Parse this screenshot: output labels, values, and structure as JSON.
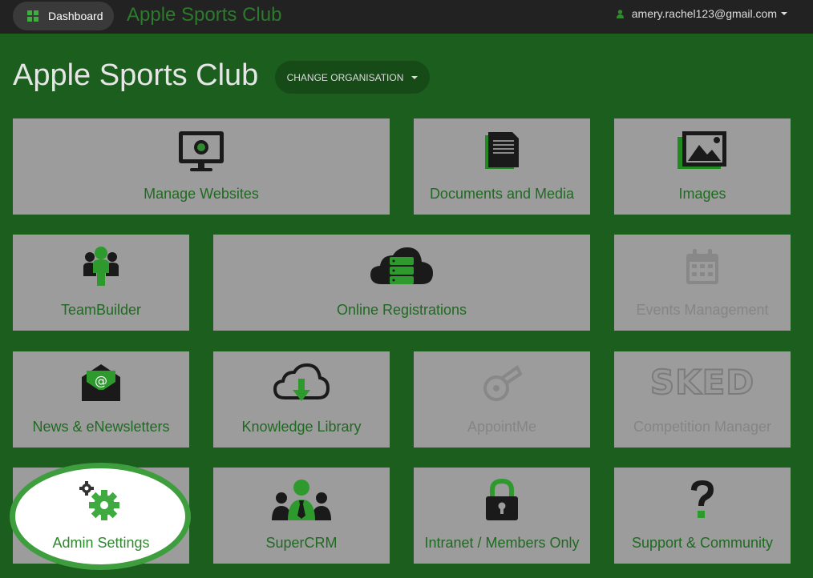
{
  "topbar": {
    "dashboard_label": "Dashboard",
    "brand": "Apple Sports Club",
    "user_email": "amery.rachel123@gmail.com"
  },
  "header": {
    "title": "Apple Sports Club",
    "change_org_label": "CHANGE ORGANISATION"
  },
  "tiles": {
    "manage_websites": "Manage Websites",
    "documents_media": "Documents and Media",
    "images": "Images",
    "teambuilder": "TeamBuilder",
    "online_registrations": "Online Registrations",
    "events_management": "Events Management",
    "news_enewsletters": "News & eNewsletters",
    "knowledge_library": "Knowledge Library",
    "appointme": "AppointMe",
    "competition_manager": "Competition Manager",
    "sked_logo_text": "SKED",
    "admin_settings": "Admin Settings",
    "supercrm": "SuperCRM",
    "intranet": "Intranet / Members Only",
    "support": "Support & Community"
  },
  "colors": {
    "background": "#1c5e1d",
    "topbar": "#222222",
    "tile": "#9c9c9c",
    "accent": "#3e9e3e",
    "label": "#1f6a21"
  }
}
